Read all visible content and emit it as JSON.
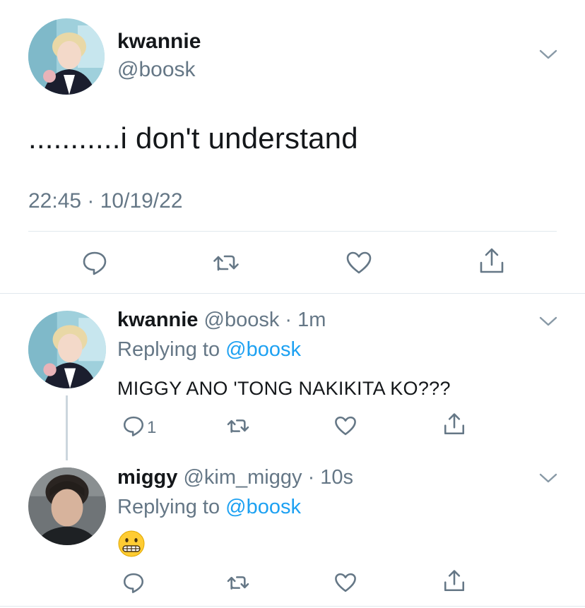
{
  "main_tweet": {
    "display_name": "kwannie",
    "handle": "@boosk",
    "text": "...........i don't understand",
    "timestamp": "22:45 · 10/19/22",
    "actions": [
      "reply-icon",
      "retweet-icon",
      "like-icon",
      "share-icon"
    ]
  },
  "replies": [
    {
      "display_name": "kwannie",
      "handle": "@boosk",
      "time": "· 1m",
      "replying_label": "Replying to",
      "replying_to": "@boosk",
      "text": "MIGGY ANO 'TONG NAKIKITA KO???",
      "reply_count": "1"
    },
    {
      "display_name": "miggy",
      "handle": "@kim_miggy",
      "time": "· 10s",
      "replying_label": "Replying to",
      "replying_to": "@boosk",
      "emoji": "grimacing-face-emoji"
    }
  ],
  "colors": {
    "text": "#14171a",
    "secondary": "#657786",
    "link": "#1da1f2",
    "divider": "#e1e8ed"
  }
}
